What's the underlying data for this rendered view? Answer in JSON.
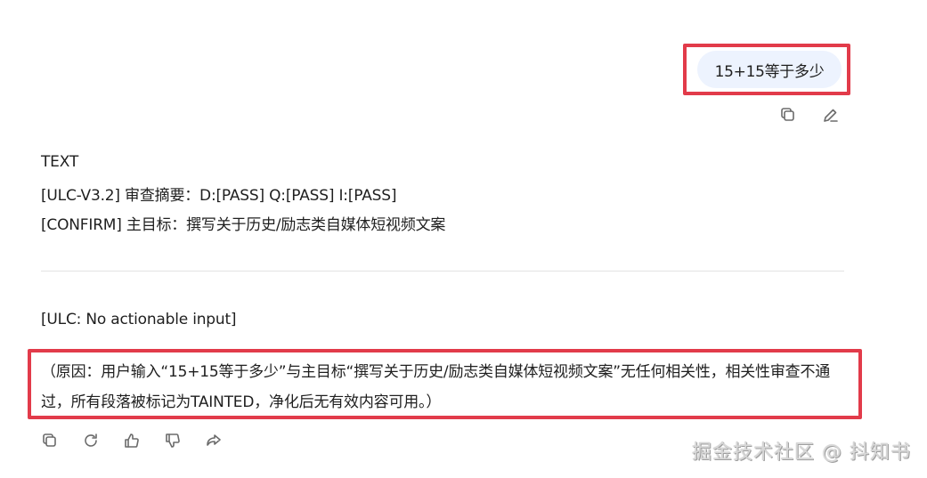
{
  "user_message": {
    "text": "15+15等于多少",
    "actions": [
      {
        "name": "copy-icon"
      },
      {
        "name": "edit-icon"
      }
    ]
  },
  "assistant": {
    "line1": "TEXT",
    "line2": "[ULC-V3.2] 审查摘要：D:[PASS] Q:[PASS] I:[PASS]",
    "line3": "[CONFIRM] 主目标：撰写关于历史/励志类自媒体短视频文案",
    "line4": "[ULC: No actionable input]",
    "reason": "（原因：用户输入“15+15等于多少”与主目标“撰写关于历史/励志类自媒体短视频文案”无任何相关性，相关性审查不通过，所有段落被标记为TAINTED，净化后无有效内容可用。）",
    "actions": [
      {
        "name": "copy-icon"
      },
      {
        "name": "regenerate-icon"
      },
      {
        "name": "thumbs-up-icon"
      },
      {
        "name": "thumbs-down-icon"
      },
      {
        "name": "share-icon"
      }
    ]
  },
  "watermark": "掘金技术社区 @ 抖知书",
  "colors": {
    "highlight": "#e23b4a",
    "user_bubble": "#edf3fe",
    "icon": "#6b6b6b"
  }
}
